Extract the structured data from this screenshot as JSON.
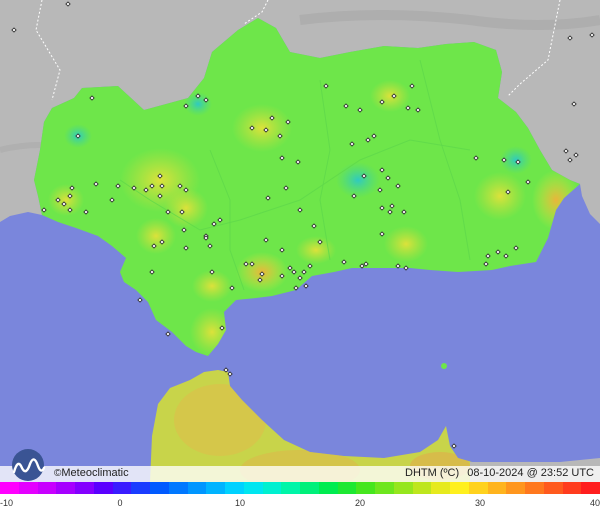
{
  "caption": {
    "variable": "DHTM (ºC)",
    "datetime": "08-10-2024 @ 23:52 UTC"
  },
  "brand": {
    "name": "Meteoclimatic",
    "copyright": "©"
  },
  "legend": {
    "ticks": [
      "-10",
      "0",
      "10",
      "20",
      "30",
      "40"
    ],
    "colors": [
      "#ff00ff",
      "#e400ff",
      "#c800ff",
      "#a600ff",
      "#8400ff",
      "#5a00ff",
      "#3a1cff",
      "#1a3cff",
      "#005aff",
      "#0078ff",
      "#0096ff",
      "#00b4ff",
      "#00d2ff",
      "#00e6f0",
      "#00f0d0",
      "#00f5a8",
      "#00f07a",
      "#00ec50",
      "#1ee832",
      "#46e61e",
      "#6ee61e",
      "#96e61e",
      "#bee61e",
      "#e6ea1e",
      "#fff01e",
      "#ffd21e",
      "#ffb41e",
      "#ff961e",
      "#ff781e",
      "#ff5a1e",
      "#ff3c1e",
      "#ff1e1e"
    ]
  },
  "colors": {
    "sea": "#7a86dc",
    "land_gray": "#b4b4b4",
    "field_green": "#6ee64a",
    "warm": "#c8dc3a",
    "cool": "#3ccfaa"
  }
}
